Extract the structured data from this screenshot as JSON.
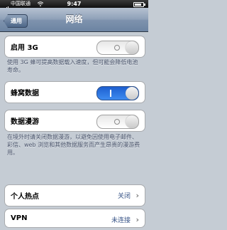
{
  "status_bar": {
    "carrier": "中国联通",
    "time": "9:47"
  },
  "nav": {
    "back_label": "通用",
    "title": "网络"
  },
  "enable_3g": {
    "label": "启用 3G",
    "state": "off",
    "note": "使用 3G 蜂可提高数据载入速度，但可能会降低电池寿命。"
  },
  "cellular_data": {
    "label": "蜂窝数据",
    "state": "on"
  },
  "data_roaming": {
    "label": "数据漫游",
    "state": "off",
    "note": "在境外时请关闭数据漫游，以避免因使用电子邮件、彩信、web 浏览和其他数据服务而产生昂贵的漫游费用。"
  },
  "hotspot": {
    "label": "个人热点",
    "value": "关闭"
  },
  "vpn": {
    "label": "VPN",
    "value": "未连接"
  }
}
